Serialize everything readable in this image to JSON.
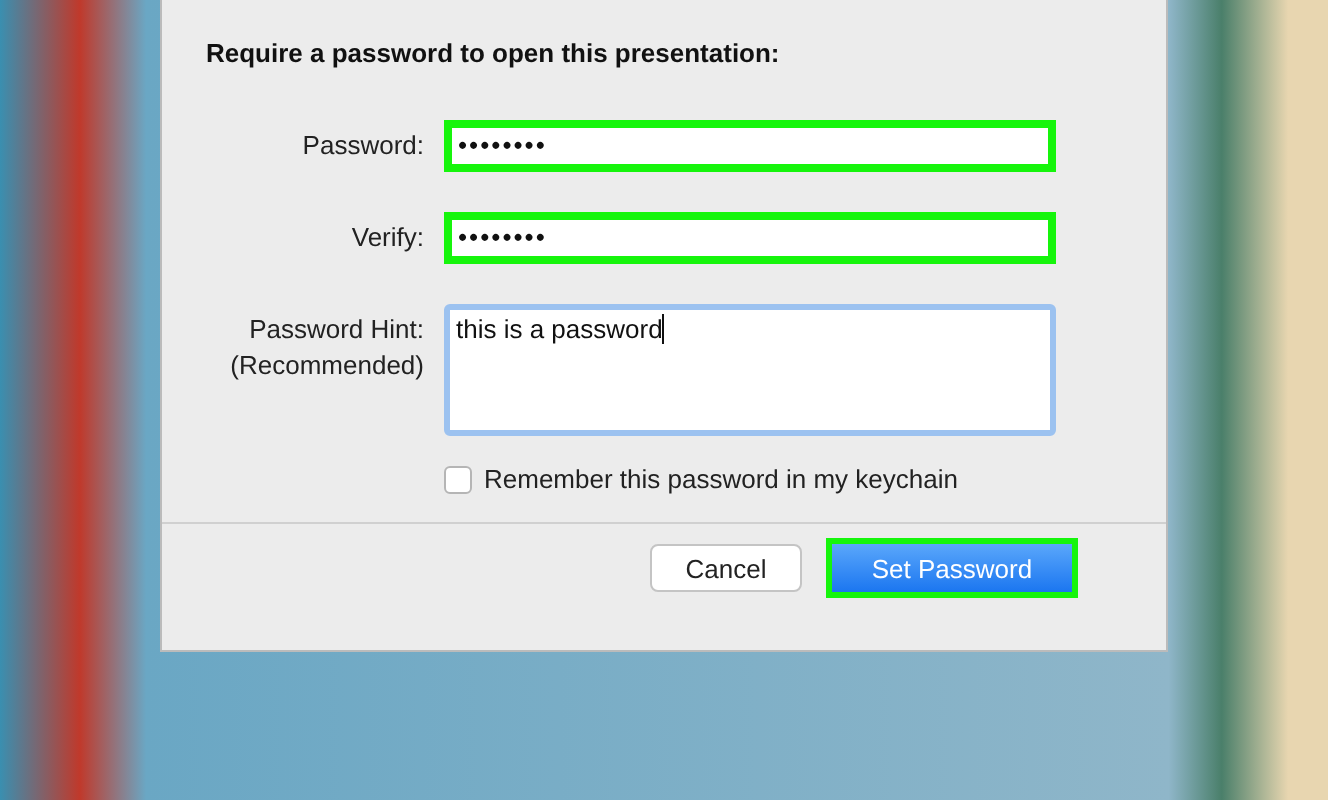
{
  "dialog": {
    "heading": "Require a password to open this presentation:",
    "fields": [
      {
        "label": "Password:",
        "value": "••••••••",
        "kind": "line",
        "highlighted": true,
        "focused": false
      },
      {
        "label": "Verify:",
        "value": "••••••••",
        "kind": "line",
        "highlighted": true,
        "focused": false
      },
      {
        "label": "Password Hint:",
        "sublabel": "(Recommended)",
        "value": "this is a password",
        "kind": "area",
        "highlighted": false,
        "focused": true
      }
    ],
    "checkbox": {
      "label": "Remember this password in my keychain",
      "checked": false
    },
    "buttons": [
      {
        "label": "Cancel",
        "kind": "secondary",
        "highlighted": false
      },
      {
        "label": "Set Password",
        "kind": "primary",
        "highlighted": true
      }
    ]
  }
}
